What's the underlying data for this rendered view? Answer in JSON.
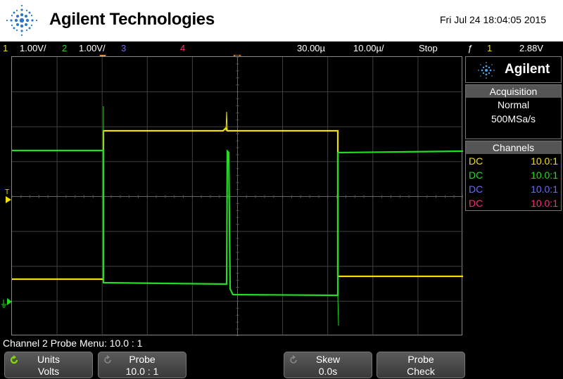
{
  "header": {
    "brand": "Agilent Technologies",
    "datetime": "Fri Jul 24 18:04:05 2015"
  },
  "statusbar": {
    "ch1_num": "1",
    "ch1_scale": "1.00V/",
    "ch2_num": "2",
    "ch2_scale": "1.00V/",
    "ch3_num": "3",
    "ch4_num": "4",
    "time_delay": "30.00µ",
    "time_scale": "10.00µ/",
    "run_state": "Stop",
    "trigger_icon": "ƒ",
    "trigger_source": "1",
    "trigger_level": "2.88V"
  },
  "side": {
    "logo_name": "Agilent",
    "acquisition_title": "Acquisition",
    "acq_mode": "Normal",
    "acq_rate": "500MSa/s",
    "channels_title": "Channels",
    "channels": [
      {
        "coupling": "DC",
        "ratio": "10.0:1",
        "color": "#f0e000"
      },
      {
        "coupling": "DC",
        "ratio": "10.0:1",
        "color": "#22dd22"
      },
      {
        "coupling": "DC",
        "ratio": "10.0:1",
        "color": "#6a6aff"
      },
      {
        "coupling": "DC",
        "ratio": "10.0:1",
        "color": "#ff2a7a"
      }
    ]
  },
  "plot": {
    "trigger_marker": "T",
    "ch1_color": "#f0e000",
    "ch2_color": "#22dd22"
  },
  "menu": {
    "title": "Channel 2 Probe Menu: 10.0 : 1",
    "softkeys": [
      {
        "top": "Units",
        "bottom": "Volts",
        "icon": "rotate-icon-green"
      },
      {
        "top": "Probe",
        "bottom": "10.0 : 1",
        "icon": "rotate-icon-gray"
      },
      {
        "top": "Skew",
        "bottom": "0.0s",
        "icon": "rotate-icon-gray"
      },
      {
        "top": "Probe",
        "bottom": "Check",
        "icon": ""
      }
    ]
  }
}
